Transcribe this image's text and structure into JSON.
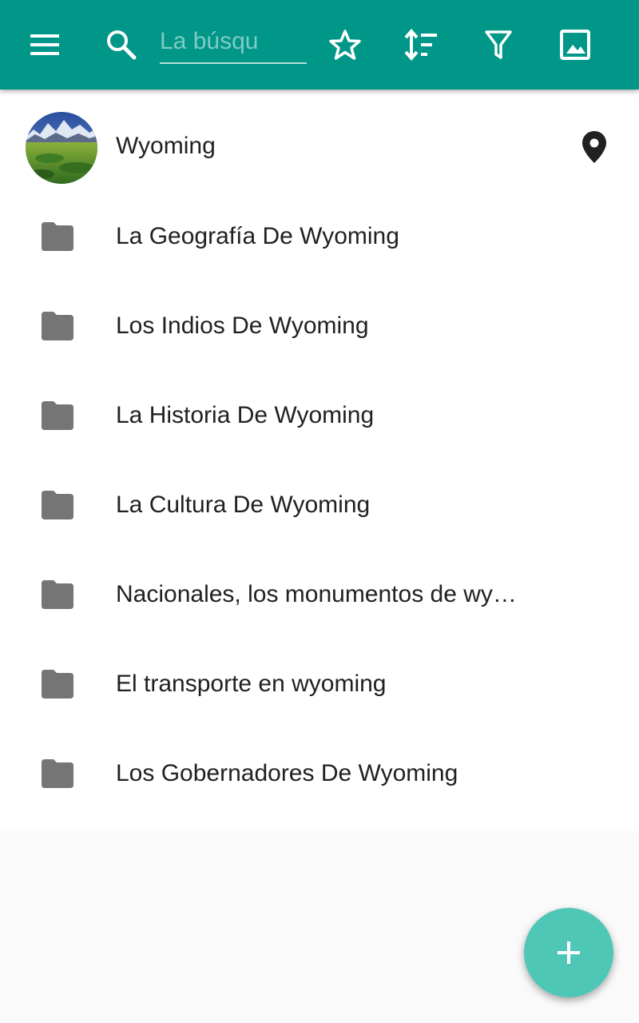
{
  "colors": {
    "toolbar": "#009688",
    "fab": "#4fc7b7",
    "folder_icon": "#757575",
    "text": "#212121"
  },
  "toolbar": {
    "menu_icon": "hamburger-menu-icon",
    "search_icon": "search-icon",
    "search_placeholder": "La búsqu",
    "search_value": "",
    "favorite_icon": "star-outline-icon",
    "sort_icon": "sort-icon",
    "filter_icon": "filter-icon",
    "image_icon": "image-icon"
  },
  "header_item": {
    "title": "Wyoming",
    "avatar": "wyoming-landscape-thumbnail",
    "location_icon": "map-pin-icon"
  },
  "folders": [
    {
      "label": "La Geografía De Wyoming"
    },
    {
      "label": "Los Indios De Wyoming"
    },
    {
      "label": "La Historia De Wyoming"
    },
    {
      "label": "La Cultura De Wyoming"
    },
    {
      "label": "Nacionales, los monumentos de wyoming"
    },
    {
      "label": "El transporte en wyoming"
    },
    {
      "label": "Los Gobernadores De Wyoming"
    }
  ],
  "fab": {
    "icon": "add-icon"
  }
}
